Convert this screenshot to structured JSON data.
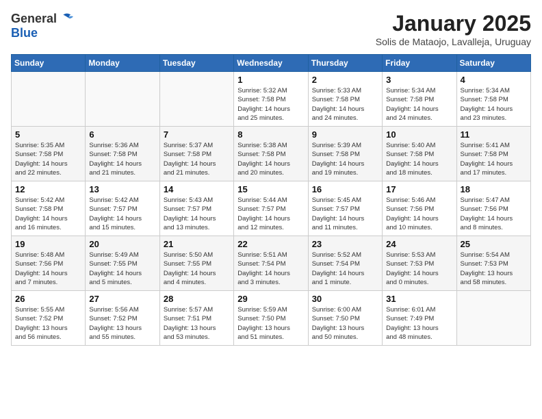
{
  "header": {
    "logo_general": "General",
    "logo_blue": "Blue",
    "month": "January 2025",
    "location": "Solis de Mataojo, Lavalleja, Uruguay"
  },
  "weekdays": [
    "Sunday",
    "Monday",
    "Tuesday",
    "Wednesday",
    "Thursday",
    "Friday",
    "Saturday"
  ],
  "weeks": [
    [
      {
        "day": "",
        "lines": []
      },
      {
        "day": "",
        "lines": []
      },
      {
        "day": "",
        "lines": []
      },
      {
        "day": "1",
        "lines": [
          "Sunrise: 5:32 AM",
          "Sunset: 7:58 PM",
          "Daylight: 14 hours",
          "and 25 minutes."
        ]
      },
      {
        "day": "2",
        "lines": [
          "Sunrise: 5:33 AM",
          "Sunset: 7:58 PM",
          "Daylight: 14 hours",
          "and 24 minutes."
        ]
      },
      {
        "day": "3",
        "lines": [
          "Sunrise: 5:34 AM",
          "Sunset: 7:58 PM",
          "Daylight: 14 hours",
          "and 24 minutes."
        ]
      },
      {
        "day": "4",
        "lines": [
          "Sunrise: 5:34 AM",
          "Sunset: 7:58 PM",
          "Daylight: 14 hours",
          "and 23 minutes."
        ]
      }
    ],
    [
      {
        "day": "5",
        "lines": [
          "Sunrise: 5:35 AM",
          "Sunset: 7:58 PM",
          "Daylight: 14 hours",
          "and 22 minutes."
        ]
      },
      {
        "day": "6",
        "lines": [
          "Sunrise: 5:36 AM",
          "Sunset: 7:58 PM",
          "Daylight: 14 hours",
          "and 21 minutes."
        ]
      },
      {
        "day": "7",
        "lines": [
          "Sunrise: 5:37 AM",
          "Sunset: 7:58 PM",
          "Daylight: 14 hours",
          "and 21 minutes."
        ]
      },
      {
        "day": "8",
        "lines": [
          "Sunrise: 5:38 AM",
          "Sunset: 7:58 PM",
          "Daylight: 14 hours",
          "and 20 minutes."
        ]
      },
      {
        "day": "9",
        "lines": [
          "Sunrise: 5:39 AM",
          "Sunset: 7:58 PM",
          "Daylight: 14 hours",
          "and 19 minutes."
        ]
      },
      {
        "day": "10",
        "lines": [
          "Sunrise: 5:40 AM",
          "Sunset: 7:58 PM",
          "Daylight: 14 hours",
          "and 18 minutes."
        ]
      },
      {
        "day": "11",
        "lines": [
          "Sunrise: 5:41 AM",
          "Sunset: 7:58 PM",
          "Daylight: 14 hours",
          "and 17 minutes."
        ]
      }
    ],
    [
      {
        "day": "12",
        "lines": [
          "Sunrise: 5:42 AM",
          "Sunset: 7:58 PM",
          "Daylight: 14 hours",
          "and 16 minutes."
        ]
      },
      {
        "day": "13",
        "lines": [
          "Sunrise: 5:42 AM",
          "Sunset: 7:57 PM",
          "Daylight: 14 hours",
          "and 15 minutes."
        ]
      },
      {
        "day": "14",
        "lines": [
          "Sunrise: 5:43 AM",
          "Sunset: 7:57 PM",
          "Daylight: 14 hours",
          "and 13 minutes."
        ]
      },
      {
        "day": "15",
        "lines": [
          "Sunrise: 5:44 AM",
          "Sunset: 7:57 PM",
          "Daylight: 14 hours",
          "and 12 minutes."
        ]
      },
      {
        "day": "16",
        "lines": [
          "Sunrise: 5:45 AM",
          "Sunset: 7:57 PM",
          "Daylight: 14 hours",
          "and 11 minutes."
        ]
      },
      {
        "day": "17",
        "lines": [
          "Sunrise: 5:46 AM",
          "Sunset: 7:56 PM",
          "Daylight: 14 hours",
          "and 10 minutes."
        ]
      },
      {
        "day": "18",
        "lines": [
          "Sunrise: 5:47 AM",
          "Sunset: 7:56 PM",
          "Daylight: 14 hours",
          "and 8 minutes."
        ]
      }
    ],
    [
      {
        "day": "19",
        "lines": [
          "Sunrise: 5:48 AM",
          "Sunset: 7:56 PM",
          "Daylight: 14 hours",
          "and 7 minutes."
        ]
      },
      {
        "day": "20",
        "lines": [
          "Sunrise: 5:49 AM",
          "Sunset: 7:55 PM",
          "Daylight: 14 hours",
          "and 5 minutes."
        ]
      },
      {
        "day": "21",
        "lines": [
          "Sunrise: 5:50 AM",
          "Sunset: 7:55 PM",
          "Daylight: 14 hours",
          "and 4 minutes."
        ]
      },
      {
        "day": "22",
        "lines": [
          "Sunrise: 5:51 AM",
          "Sunset: 7:54 PM",
          "Daylight: 14 hours",
          "and 3 minutes."
        ]
      },
      {
        "day": "23",
        "lines": [
          "Sunrise: 5:52 AM",
          "Sunset: 7:54 PM",
          "Daylight: 14 hours",
          "and 1 minute."
        ]
      },
      {
        "day": "24",
        "lines": [
          "Sunrise: 5:53 AM",
          "Sunset: 7:53 PM",
          "Daylight: 14 hours",
          "and 0 minutes."
        ]
      },
      {
        "day": "25",
        "lines": [
          "Sunrise: 5:54 AM",
          "Sunset: 7:53 PM",
          "Daylight: 13 hours",
          "and 58 minutes."
        ]
      }
    ],
    [
      {
        "day": "26",
        "lines": [
          "Sunrise: 5:55 AM",
          "Sunset: 7:52 PM",
          "Daylight: 13 hours",
          "and 56 minutes."
        ]
      },
      {
        "day": "27",
        "lines": [
          "Sunrise: 5:56 AM",
          "Sunset: 7:52 PM",
          "Daylight: 13 hours",
          "and 55 minutes."
        ]
      },
      {
        "day": "28",
        "lines": [
          "Sunrise: 5:57 AM",
          "Sunset: 7:51 PM",
          "Daylight: 13 hours",
          "and 53 minutes."
        ]
      },
      {
        "day": "29",
        "lines": [
          "Sunrise: 5:59 AM",
          "Sunset: 7:50 PM",
          "Daylight: 13 hours",
          "and 51 minutes."
        ]
      },
      {
        "day": "30",
        "lines": [
          "Sunrise: 6:00 AM",
          "Sunset: 7:50 PM",
          "Daylight: 13 hours",
          "and 50 minutes."
        ]
      },
      {
        "day": "31",
        "lines": [
          "Sunrise: 6:01 AM",
          "Sunset: 7:49 PM",
          "Daylight: 13 hours",
          "and 48 minutes."
        ]
      },
      {
        "day": "",
        "lines": []
      }
    ]
  ]
}
